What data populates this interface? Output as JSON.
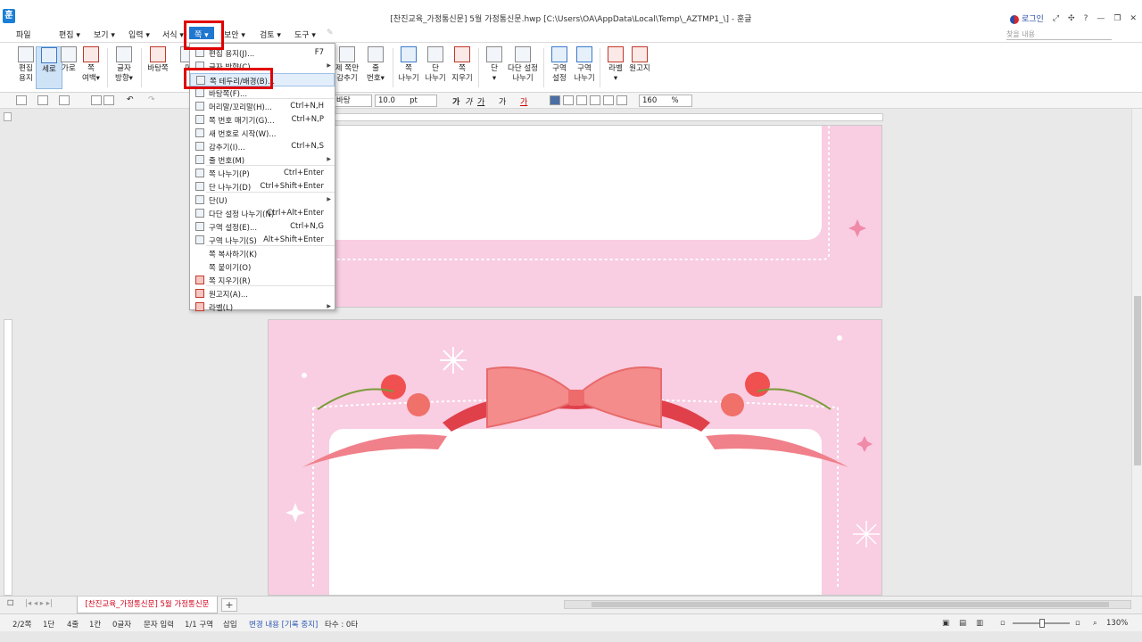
{
  "window": {
    "title": "[찬진교육_가정통신문] 5월 가정통신문.hwp [C:\\Users\\OA\\AppData\\Local\\Temp\\_AZTMP1_\\] - 훈글",
    "logo": "훈",
    "login": "로그인"
  },
  "menubar": {
    "items": [
      "파일",
      "편집 ▾",
      "보기 ▾",
      "입력 ▾",
      "서식 ▾",
      "쪽",
      "보안 ▾",
      "검토 ▾",
      "도구 ▾"
    ],
    "active_index": 5,
    "search_placeholder": "찾을 내용"
  },
  "ribbon": {
    "buttons": [
      {
        "label": "편집\n용지",
        "icon": "page-setup-icon"
      },
      {
        "label": "세로",
        "icon": "portrait-icon"
      },
      {
        "label": "가로",
        "icon": "landscape-icon"
      },
      {
        "label": "쪽\n여백▾",
        "icon": "margin-icon"
      },
      {
        "label": "글자\n방향▾",
        "icon": "text-direction-icon"
      },
      {
        "label": "바탕쪽",
        "icon": "master-page-icon"
      },
      {
        "label": "머",
        "icon": "header-icon"
      },
      {
        "label": "제 쪽만\n감추기",
        "icon": "hide-icon"
      },
      {
        "label": "줄\n번호▾",
        "icon": "line-number-icon"
      },
      {
        "label": "쪽\n나누기",
        "icon": "page-break-icon"
      },
      {
        "label": "단\n나누기",
        "icon": "column-break-icon"
      },
      {
        "label": "쪽\n지우기",
        "icon": "delete-page-icon"
      },
      {
        "label": "단\n▾",
        "icon": "columns-icon"
      },
      {
        "label": "다단 설정\n나누기",
        "icon": "multi-column-icon"
      },
      {
        "label": "구역\n설정",
        "icon": "section-setup-icon"
      },
      {
        "label": "구역\n나누기",
        "icon": "section-break-icon"
      },
      {
        "label": "라벨\n▾",
        "icon": "label-icon"
      },
      {
        "label": "원고지",
        "icon": "manuscript-icon"
      }
    ]
  },
  "format_bar": {
    "font": "바탕",
    "size": "10.0",
    "unit": "pt",
    "styles": [
      "가",
      "가",
      "가",
      "가",
      "가"
    ],
    "zoom": "160",
    "zoom_unit": "%"
  },
  "dropdown": {
    "items": [
      {
        "label": "편집 용지(J)...",
        "shortcut": "F7",
        "arrow": false,
        "icon": "page-setup-icon",
        "red": false
      },
      {
        "label": "글자 방향(C)",
        "shortcut": "",
        "arrow": true,
        "icon": "text-direction-icon",
        "red": false
      },
      {
        "label": "쪽 테두리/배경(B)...",
        "shortcut": "",
        "arrow": false,
        "icon": "page-border-icon",
        "red": false,
        "highlight": true
      },
      {
        "label": "바탕쪽(F)...",
        "shortcut": "",
        "arrow": false,
        "icon": "master-page-icon",
        "red": false
      },
      {
        "label": "머리말/꼬리말(H)...",
        "shortcut": "Ctrl+N,H",
        "arrow": false,
        "icon": "header-footer-icon",
        "red": false
      },
      {
        "label": "쪽 번호 매기기(G)...",
        "shortcut": "Ctrl+N,P",
        "arrow": false,
        "icon": "page-number-icon",
        "red": false
      },
      {
        "label": "새 번호로 시작(W)...",
        "shortcut": "",
        "arrow": false,
        "icon": "new-number-icon",
        "red": false
      },
      {
        "label": "감추기(I)...",
        "shortcut": "Ctrl+N,S",
        "arrow": false,
        "icon": "hide-icon",
        "red": false
      },
      {
        "label": "줄 번호(M)",
        "shortcut": "",
        "arrow": true,
        "icon": "line-number-icon",
        "red": false
      },
      {
        "label": "쪽 나누기(P)",
        "shortcut": "Ctrl+Enter",
        "arrow": false,
        "icon": "page-break-icon",
        "red": false
      },
      {
        "label": "단 나누기(D)",
        "shortcut": "Ctrl+Shift+Enter",
        "arrow": false,
        "icon": "column-break-icon",
        "red": false
      },
      {
        "label": "단(U)",
        "shortcut": "",
        "arrow": true,
        "icon": "columns-icon",
        "red": false
      },
      {
        "label": "다단 설정 나누기(N)",
        "shortcut": "Ctrl+Alt+Enter",
        "arrow": false,
        "icon": "multi-column-icon",
        "red": false
      },
      {
        "label": "구역 설정(E)...",
        "shortcut": "Ctrl+N,G",
        "arrow": false,
        "icon": "section-setup-icon",
        "red": false
      },
      {
        "label": "구역 나누기(S)",
        "shortcut": "Alt+Shift+Enter",
        "arrow": false,
        "icon": "section-break-icon",
        "red": false
      },
      {
        "label": "쪽 복사하기(K)",
        "shortcut": "",
        "arrow": false,
        "icon": "",
        "red": false
      },
      {
        "label": "쪽 붙이기(O)",
        "shortcut": "",
        "arrow": false,
        "icon": "",
        "red": false
      },
      {
        "label": "쪽 지우기(R)",
        "shortcut": "",
        "arrow": false,
        "icon": "delete-page-icon",
        "red": true
      },
      {
        "label": "원고지(A)...",
        "shortcut": "",
        "arrow": false,
        "icon": "manuscript-icon",
        "red": true
      },
      {
        "label": "라벨(L)",
        "shortcut": "",
        "arrow": true,
        "icon": "label-icon",
        "red": true
      }
    ]
  },
  "tabs": {
    "doc_tab": "[찬진교육_가정통신문] 5월 가정통신문",
    "add": "+"
  },
  "statusbar": {
    "page": "2/2쪽",
    "column": "1단",
    "line": "4줄",
    "col": "1칸",
    "chars": "0글자",
    "mode": "문자 입력",
    "section": "1/1 구역",
    "insert": "삽입",
    "track": "변경 내용 [기록 중지]",
    "typo": "타수 : 0타",
    "zoom": "130%"
  },
  "colors": {
    "accent": "#1f77d0",
    "page_pink": "#f9cde2",
    "highlight_box": "#e00000"
  }
}
